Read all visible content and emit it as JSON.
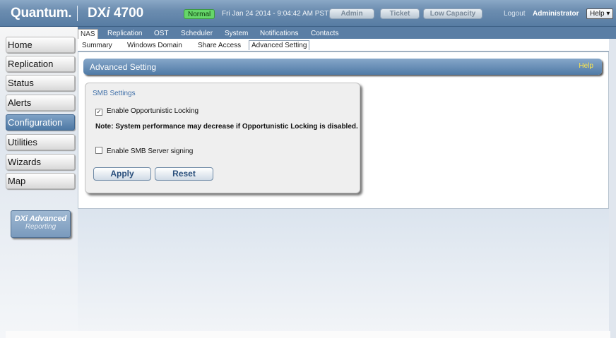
{
  "header": {
    "logo": "Quantum.",
    "product_prefix": "DX",
    "product_italic": "i",
    "product_model": " 4700",
    "status_badge": "Normal",
    "datetime": "Fri Jan 24 2014 - 9:04:42 AM PST",
    "admin_button": "Admin",
    "ticket_button": "Ticket",
    "low_capacity_button": "Low Capacity",
    "logout": "Logout",
    "user": "Administrator",
    "help_menu": "Help ▾",
    "status_color": "#66d66a"
  },
  "sidebar": {
    "items": [
      {
        "label": "Home"
      },
      {
        "label": "Replication"
      },
      {
        "label": "Status"
      },
      {
        "label": "Alerts"
      },
      {
        "label": "Configuration",
        "active": true
      },
      {
        "label": "Utilities"
      },
      {
        "label": "Wizards"
      },
      {
        "label": "Map"
      }
    ],
    "dxi_line1": "DXi Advanced",
    "dxi_line2": "Reporting"
  },
  "top_tabs": [
    "NAS",
    "Replication",
    "OST",
    "Scheduler",
    "System",
    "Notifications",
    "Contacts"
  ],
  "top_tabs_active": "NAS",
  "sub_tabs": [
    "Summary",
    "Windows Domain",
    "Share Access",
    "Advanced Setting"
  ],
  "sub_tabs_active": "Advanced Setting",
  "panel": {
    "title": "Advanced Setting",
    "help": "Help"
  },
  "smb": {
    "title": "SMB Settings",
    "opportunistic_locking_label": "Enable Opportunistic Locking",
    "opportunistic_locking_checked": true,
    "note": "Note: System performance may decrease if Opportunistic Locking is disabled.",
    "smb_signing_label": "Enable SMB Server signing",
    "smb_signing_checked": false,
    "apply_button": "Apply",
    "reset_button": "Reset"
  },
  "colors": {
    "accent": "#4f7aa6",
    "help_text": "#ffe64a"
  }
}
